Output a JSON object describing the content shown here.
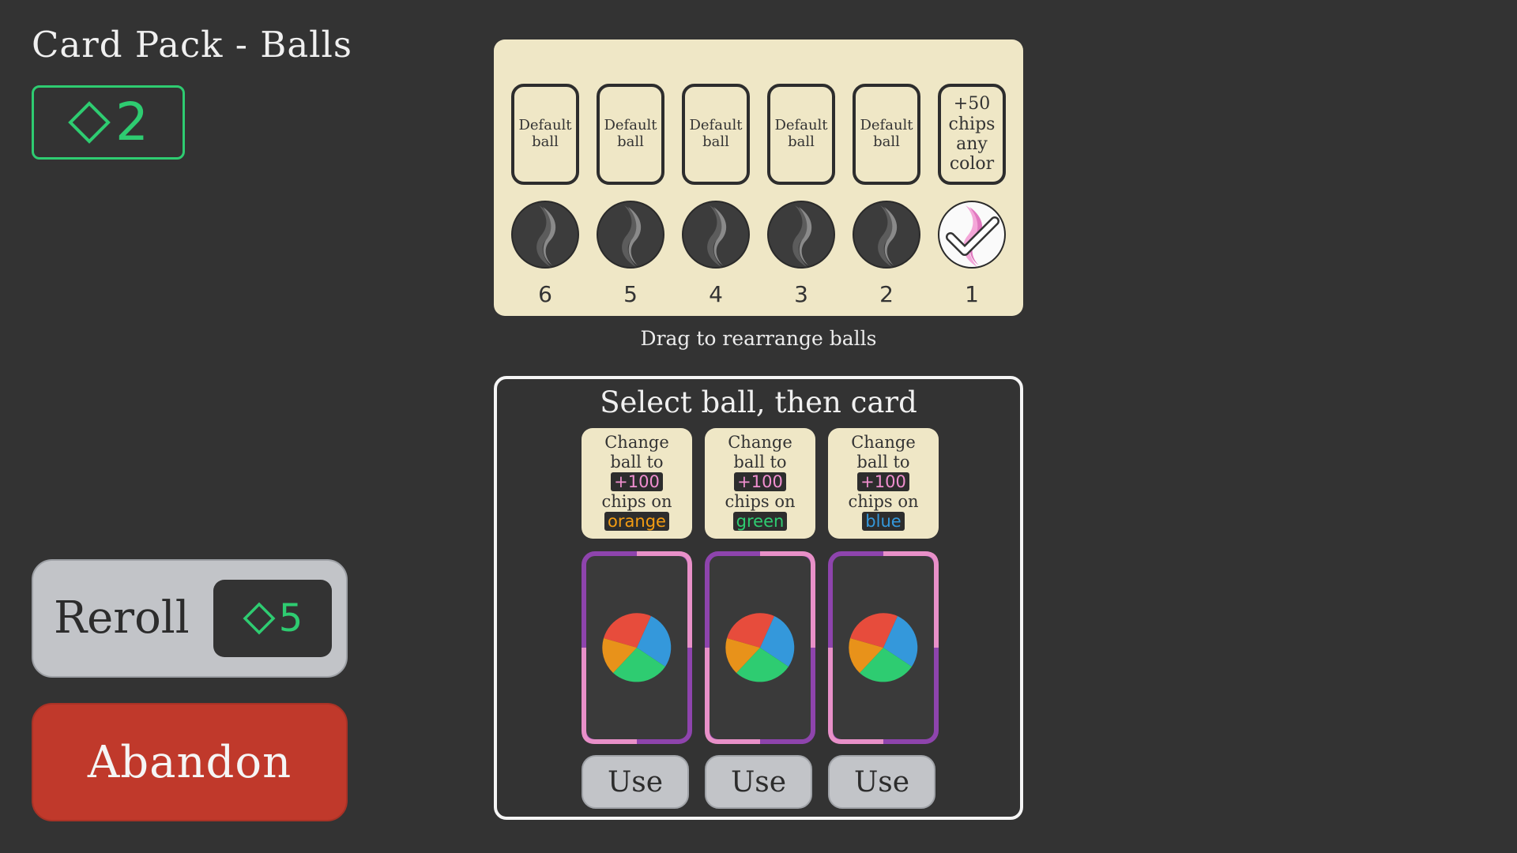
{
  "header": {
    "title": "Card Pack - Balls"
  },
  "currency": {
    "icon": "diamond-icon",
    "value": "2",
    "color": "#2ecc71"
  },
  "reroll": {
    "label": "Reroll",
    "icon": "diamond-icon",
    "cost": "5"
  },
  "abandon": {
    "label": "Abandon",
    "color": "#c0392b"
  },
  "balls": {
    "slots": [
      {
        "card_text": "Default ball",
        "number": "6",
        "ball": "default-ball-icon",
        "selected": false
      },
      {
        "card_text": "Default ball",
        "number": "5",
        "ball": "default-ball-icon",
        "selected": false
      },
      {
        "card_text": "Default ball",
        "number": "4",
        "ball": "default-ball-icon",
        "selected": false
      },
      {
        "card_text": "Default ball",
        "number": "3",
        "ball": "default-ball-icon",
        "selected": false
      },
      {
        "card_text": "Default ball",
        "number": "2",
        "ball": "default-ball-icon",
        "selected": false
      },
      {
        "card_text": "+50 chips any color",
        "number": "1",
        "ball": "pink-ball-icon",
        "selected": true
      }
    ],
    "hint": "Drag to rearrange balls"
  },
  "selection": {
    "title": "Select ball, then card",
    "offers": [
      {
        "line1": "Change",
        "line2": "ball to",
        "amount": "+100",
        "line3": "chips on",
        "color_word": "orange",
        "use_label": "Use",
        "card_icon": "multicolor-ball-icon"
      },
      {
        "line1": "Change",
        "line2": "ball to",
        "amount": "+100",
        "line3": "chips on",
        "color_word": "green",
        "use_label": "Use",
        "card_icon": "multicolor-ball-icon"
      },
      {
        "line1": "Change",
        "line2": "ball to",
        "amount": "+100",
        "line3": "chips on",
        "color_word": "blue",
        "use_label": "Use",
        "card_icon": "multicolor-ball-icon"
      }
    ]
  },
  "colors": {
    "background": "#333333",
    "panel": "#efe7c6",
    "accent_green": "#2ecc71",
    "card_border_purple": "#8e44ad",
    "card_border_pink": "#e890c8"
  }
}
